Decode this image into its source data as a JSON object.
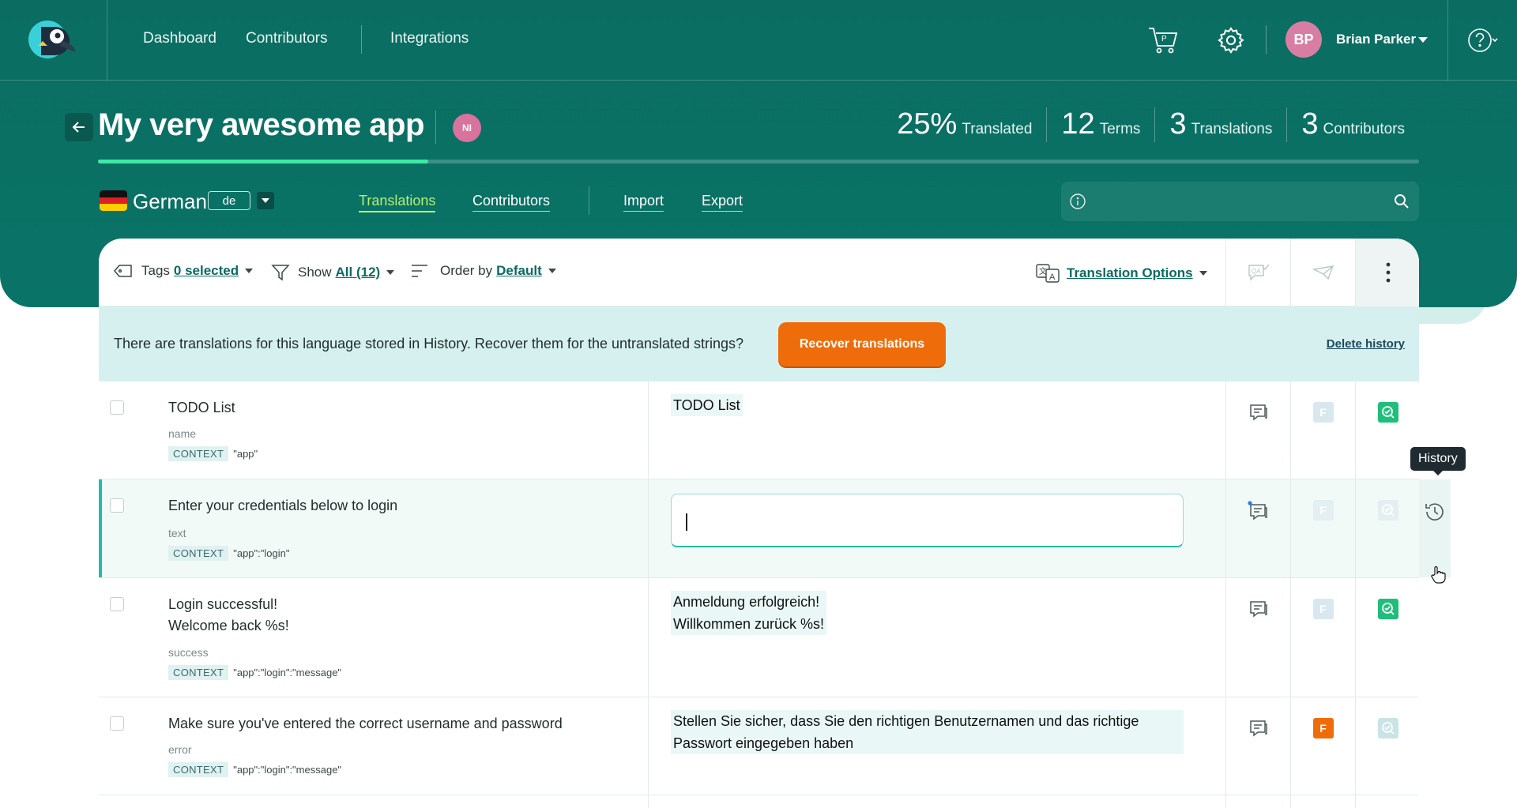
{
  "nav": {
    "dashboard": "Dashboard",
    "contributors": "Contributors",
    "integrations": "Integrations"
  },
  "user": {
    "initials": "BP",
    "name": "Brian Parker"
  },
  "icons": {
    "logo": "poeditor-parrot-logo",
    "cart": "cart-icon",
    "settings": "gear-icon",
    "help": "help-icon",
    "back": "arrow-left-icon",
    "search": "search-icon",
    "info": "info-icon"
  },
  "project": {
    "title": "My very awesome app",
    "badge": "NI",
    "progress_fraction": 0.25,
    "stats": [
      {
        "value": "25%",
        "label": "Translated"
      },
      {
        "value": "12",
        "label": "Terms"
      },
      {
        "value": "3",
        "label": "Translations"
      },
      {
        "value": "3",
        "label": "Contributors"
      }
    ]
  },
  "language": {
    "name": "German",
    "code": "de"
  },
  "subtabs": {
    "translations": "Translations",
    "contributors": "Contributors",
    "import": "Import",
    "export": "Export"
  },
  "search": {
    "placeholder": ""
  },
  "toolbar": {
    "tags_label": "Tags",
    "tags_value": "0 selected",
    "show_label": "Show",
    "show_value": "All (12)",
    "order_label": "Order by",
    "order_value": "Default",
    "translation_options": "Translation Options"
  },
  "banner": {
    "text": "There are translations for this language stored in History. Recover them for the untranslated strings?",
    "recover_button": "Recover translations",
    "delete_link": "Delete history"
  },
  "context_tag": "CONTEXT",
  "rows": [
    {
      "source": "TODO List",
      "key": "name",
      "context": "\"app\"",
      "translation": "TODO List",
      "fuzzy": false,
      "proofread": true
    },
    {
      "source": "Enter your credentials below to login",
      "key": "text",
      "context": "\"app\":\"login\"",
      "translation": "",
      "fuzzy": false,
      "proofread": false
    },
    {
      "source": "Login successful!\nWelcome back %s!",
      "key": "success",
      "context": "\"app\":\"login\":\"message\"",
      "translation": "Anmeldung erfolgreich!\nWillkommen zurück %s!",
      "fuzzy": false,
      "proofread": true
    },
    {
      "source": "Make sure you've entered the correct username and password",
      "key": "error",
      "context": "\"app\":\"login\":\"message\"",
      "translation": "Stellen Sie sicher, dass Sie den richtigen Benutzernamen und das richtige\nPasswort eingegeben haben",
      "fuzzy": true,
      "proofread": false
    }
  ],
  "fuzzy_letter": "F",
  "tooltip": "History",
  "colors": {
    "brand": "#0b6d61",
    "accent_orange": "#ef6c0b",
    "proofread_green": "#1fbf7a",
    "progress": "#3fe8a6"
  }
}
